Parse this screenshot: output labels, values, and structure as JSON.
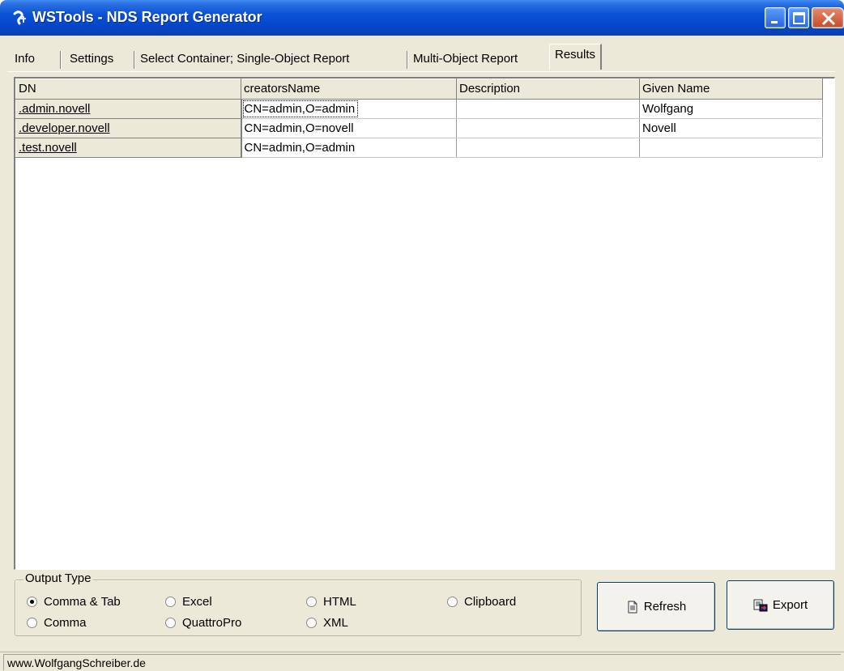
{
  "window": {
    "title": "WSTools - NDS Report Generator"
  },
  "tabs": [
    {
      "label": "Info"
    },
    {
      "label": "Settings"
    },
    {
      "label": "Select Container; Single-Object Report"
    },
    {
      "label": "Multi-Object Report"
    },
    {
      "label": "Results",
      "active": true
    }
  ],
  "grid": {
    "headers": [
      "DN",
      "creatorsName",
      "Description",
      "Given Name"
    ],
    "rows": [
      {
        "dn": ".admin.novell",
        "creatorsName": "CN=admin,O=admin",
        "description": "",
        "givenName": "Wolfgang"
      },
      {
        "dn": ".developer.novell",
        "creatorsName": "CN=admin,O=novell",
        "description": "",
        "givenName": "Novell"
      },
      {
        "dn": ".test.novell",
        "creatorsName": "CN=admin,O=admin",
        "description": "",
        "givenName": ""
      }
    ]
  },
  "output_type": {
    "label": "Output Type",
    "selected": "Comma & Tab",
    "options": [
      {
        "label": "Comma & Tab",
        "checked": true
      },
      {
        "label": "Excel",
        "checked": false
      },
      {
        "label": "HTML",
        "checked": false
      },
      {
        "label": "Clipboard",
        "checked": false
      },
      {
        "label": "Comma",
        "checked": false
      },
      {
        "label": "QuattroPro",
        "checked": false
      },
      {
        "label": "XML",
        "checked": false
      }
    ]
  },
  "buttons": {
    "refresh": {
      "label": "Refresh",
      "icon": "refresh-icon"
    },
    "export": {
      "label": "Export",
      "icon": "export-icon"
    }
  },
  "statusbar": {
    "text": "www.WolfgangSchreiber.de"
  },
  "colors": {
    "titlebar": "#0a52d6",
    "window_bg": "#ece9d8",
    "grid_bg": "#ffffff"
  }
}
